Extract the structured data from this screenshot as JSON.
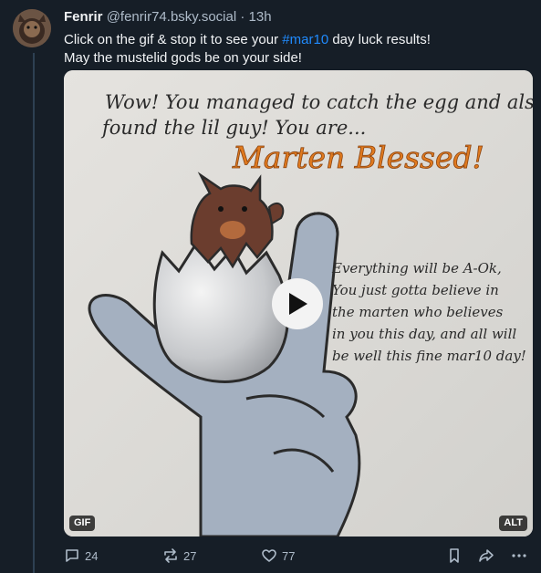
{
  "post": {
    "display_name": "Fenrir",
    "handle": "@fenrir74.bsky.social",
    "separator": "·",
    "time": "13h",
    "text_line1_before": "Click on the gif & stop it to see your ",
    "hashtag": "#mar10",
    "text_line1_after": " day luck results!",
    "text_line2": "May the mustelid gods be on your side!"
  },
  "media": {
    "caption_line1": "Wow! You managed to catch the egg and also",
    "caption_line2": "found the lil guy! You are...",
    "headline": "Marten Blessed!",
    "message_lines": [
      "Everything will be A-Ok,",
      "You just gotta believe in",
      "the marten who believes",
      "in you this day, and all will",
      "be well this fine mar10 day!"
    ],
    "badge_gif": "GIF",
    "badge_alt": "ALT",
    "play_icon": "play-icon"
  },
  "actions": {
    "reply_count": "24",
    "repost_count": "27",
    "like_count": "77",
    "icons": [
      "reply-icon",
      "repost-icon",
      "like-icon",
      "bookmark-icon",
      "share-icon",
      "more-icon"
    ]
  },
  "colors": {
    "background": "#161e27",
    "hashtag": "#208bfe",
    "muted": "#aebbc9",
    "headline": "#e07a1f"
  }
}
